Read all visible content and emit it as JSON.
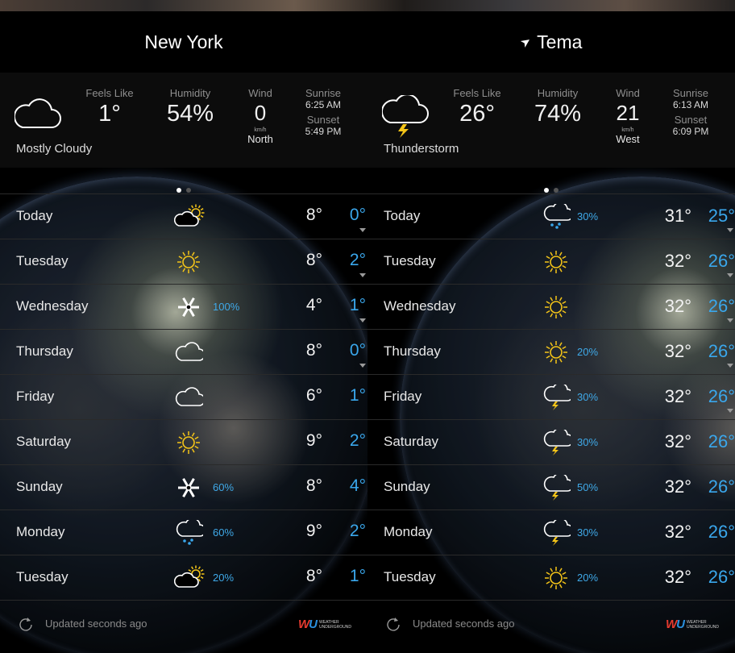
{
  "colors": {
    "accent_low": "#3aa7ec",
    "background": "#000000",
    "sun": "#f5c518"
  },
  "panels": [
    {
      "city": "New York",
      "location_arrow": false,
      "current": {
        "icon": "cloud-icon",
        "condition": "Mostly Cloudy",
        "feels_like_label": "Feels Like",
        "feels_like": "1°",
        "humidity_label": "Humidity",
        "humidity": "54%",
        "wind_label": "Wind",
        "wind_speed": "0",
        "wind_unit": "km/h",
        "wind_dir": "North",
        "sunrise_label": "Sunrise",
        "sunrise": "6:25 AM",
        "sunset_label": "Sunset",
        "sunset": "5:49 PM"
      },
      "forecast": [
        {
          "day": "Today",
          "icon": "partly-cloudy-icon",
          "pct": "",
          "hi": "8°",
          "lo": "0°",
          "caret": true
        },
        {
          "day": "Tuesday",
          "icon": "sun-icon",
          "pct": "",
          "hi": "8°",
          "lo": "2°",
          "caret": true
        },
        {
          "day": "Wednesday",
          "icon": "snowflake-icon",
          "pct": "100%",
          "hi": "4°",
          "lo": "1°",
          "caret": true
        },
        {
          "day": "Thursday",
          "icon": "cloud-icon",
          "pct": "",
          "hi": "8°",
          "lo": "0°",
          "caret": true
        },
        {
          "day": "Friday",
          "icon": "cloud-icon",
          "pct": "",
          "hi": "6°",
          "lo": "1°",
          "caret": false
        },
        {
          "day": "Saturday",
          "icon": "sun-icon",
          "pct": "",
          "hi": "9°",
          "lo": "2°",
          "caret": false
        },
        {
          "day": "Sunday",
          "icon": "snowflake-icon",
          "pct": "60%",
          "hi": "8°",
          "lo": "4°",
          "caret": false
        },
        {
          "day": "Monday",
          "icon": "rain-icon",
          "pct": "60%",
          "hi": "9°",
          "lo": "2°",
          "caret": false
        },
        {
          "day": "Tuesday",
          "icon": "partly-cloudy-icon",
          "pct": "20%",
          "hi": "8°",
          "lo": "1°",
          "caret": false
        }
      ],
      "updated": "Updated seconds ago"
    },
    {
      "city": "Tema",
      "location_arrow": true,
      "current": {
        "icon": "thunderstorm-icon",
        "condition": "Thunderstorm",
        "feels_like_label": "Feels Like",
        "feels_like": "26°",
        "humidity_label": "Humidity",
        "humidity": "74%",
        "wind_label": "Wind",
        "wind_speed": "21",
        "wind_unit": "km/h",
        "wind_dir": "West",
        "sunrise_label": "Sunrise",
        "sunrise": "6:13 AM",
        "sunset_label": "Sunset",
        "sunset": "6:09 PM"
      },
      "forecast": [
        {
          "day": "Today",
          "icon": "rain-icon",
          "pct": "30%",
          "hi": "31°",
          "lo": "25°",
          "caret": true
        },
        {
          "day": "Tuesday",
          "icon": "sun-icon",
          "pct": "",
          "hi": "32°",
          "lo": "26°",
          "caret": true
        },
        {
          "day": "Wednesday",
          "icon": "sun-icon",
          "pct": "",
          "hi": "32°",
          "lo": "26°",
          "caret": true
        },
        {
          "day": "Thursday",
          "icon": "sun-icon",
          "pct": "20%",
          "hi": "32°",
          "lo": "26°",
          "caret": true
        },
        {
          "day": "Friday",
          "icon": "thunderstorm-icon",
          "pct": "30%",
          "hi": "32°",
          "lo": "26°",
          "caret": true
        },
        {
          "day": "Saturday",
          "icon": "thunderstorm-icon",
          "pct": "30%",
          "hi": "32°",
          "lo": "26°",
          "caret": false
        },
        {
          "day": "Sunday",
          "icon": "thunderstorm-icon",
          "pct": "50%",
          "hi": "32°",
          "lo": "26°",
          "caret": false
        },
        {
          "day": "Monday",
          "icon": "thunderstorm-icon",
          "pct": "30%",
          "hi": "32°",
          "lo": "26°",
          "caret": false
        },
        {
          "day": "Tuesday",
          "icon": "sun-icon",
          "pct": "20%",
          "hi": "32°",
          "lo": "26°",
          "caret": false
        }
      ],
      "updated": "Updated seconds ago"
    }
  ],
  "brand": {
    "mark": "WU",
    "text_line1": "WEATHER",
    "text_line2": "UNDERGROUND"
  }
}
